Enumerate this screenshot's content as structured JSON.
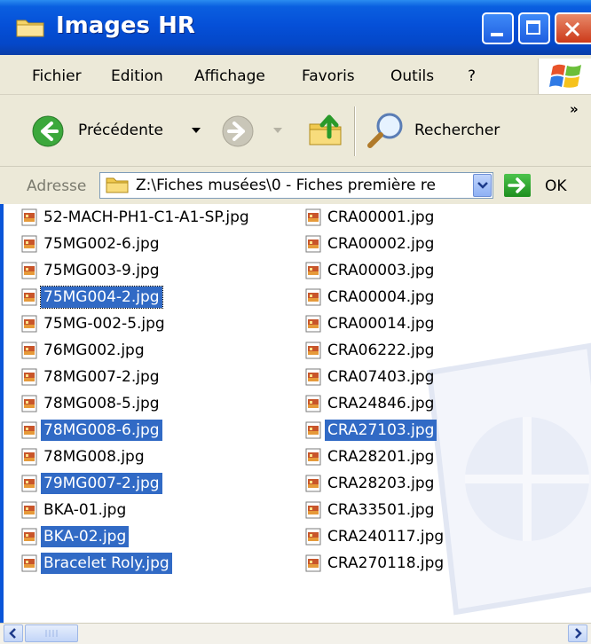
{
  "window": {
    "title": "Images HR",
    "icon": "folder-icon"
  },
  "menu": [
    "Fichier",
    "Edition",
    "Affichage",
    "Favoris",
    "Outils",
    "?"
  ],
  "toolbar": {
    "back_label": "Précédente",
    "search_label": "Rechercher",
    "more": "»"
  },
  "address": {
    "label": "Adresse",
    "value": "Z:\\Fiches musées\\0 - Fiches première re",
    "go_label": "OK"
  },
  "files": {
    "column1": [
      {
        "name": "52-MACH-PH1-C1-A1-SP.jpg",
        "selected": false
      },
      {
        "name": "75MG002-6.jpg",
        "selected": false
      },
      {
        "name": "75MG003-9.jpg",
        "selected": false
      },
      {
        "name": "75MG004-2.jpg",
        "selected": true
      },
      {
        "name": "75MG-002-5.jpg",
        "selected": false
      },
      {
        "name": "76MG002.jpg",
        "selected": false
      },
      {
        "name": "78MG007-2.jpg",
        "selected": false
      },
      {
        "name": "78MG008-5.jpg",
        "selected": false
      },
      {
        "name": "78MG008-6.jpg",
        "selected": true
      },
      {
        "name": "78MG008.jpg",
        "selected": false
      },
      {
        "name": "79MG007-2.jpg",
        "selected": true
      },
      {
        "name": "BKA-01.jpg",
        "selected": false
      },
      {
        "name": "BKA-02.jpg",
        "selected": true
      },
      {
        "name": "Bracelet Roly.jpg",
        "selected": true
      }
    ],
    "column2": [
      {
        "name": "CRA00001.jpg",
        "selected": false
      },
      {
        "name": "CRA00002.jpg",
        "selected": false
      },
      {
        "name": "CRA00003.jpg",
        "selected": false
      },
      {
        "name": "CRA00004.jpg",
        "selected": false
      },
      {
        "name": "CRA00014.jpg",
        "selected": false
      },
      {
        "name": "CRA06222.jpg",
        "selected": false
      },
      {
        "name": "CRA07403.jpg",
        "selected": false
      },
      {
        "name": "CRA24846.jpg",
        "selected": false
      },
      {
        "name": "CRA27103.jpg",
        "selected": true
      },
      {
        "name": "CRA28201.jpg",
        "selected": false
      },
      {
        "name": "CRA28203.jpg",
        "selected": false
      },
      {
        "name": "CRA33501.jpg",
        "selected": false
      },
      {
        "name": "CRA240117.jpg",
        "selected": false
      },
      {
        "name": "CRA270118.jpg",
        "selected": false
      }
    ]
  },
  "colors": {
    "titlebar": "#0550d8",
    "selection": "#316ac5",
    "chrome": "#ece9d8"
  }
}
